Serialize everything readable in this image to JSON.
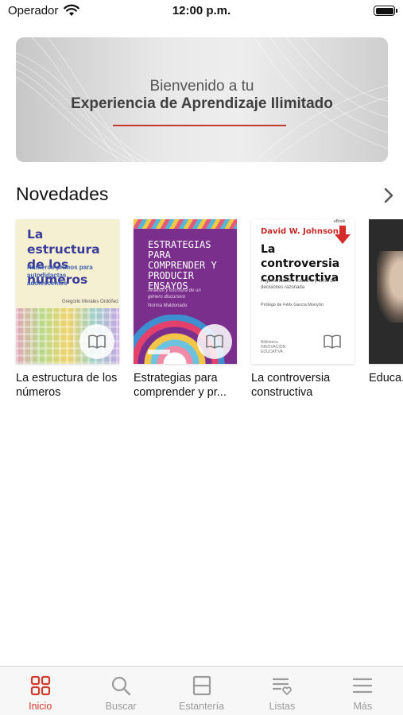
{
  "status_bar": {
    "carrier": "Operador",
    "time": "12:00 p.m."
  },
  "banner": {
    "line1": "Bienvenido a tu",
    "line2": "Experiencia de Aprendizaje Ilimitado"
  },
  "section": {
    "title": "Novedades"
  },
  "books": [
    {
      "title": "La estructura de los números",
      "cover": {
        "title": "La estructura de los números",
        "subtitle": "Números primos para autodidactas adolescentes",
        "author": "Gregorio Morales Ordóñez"
      }
    },
    {
      "title": "Estrategias para comprender y pr...",
      "cover": {
        "title": "ESTRATEGIAS PARA COMPRENDER Y PRODUCIR ENSAYOS",
        "subtitle": "Análisis y escritura de un género discursivo",
        "author": "Norma Maldonado"
      }
    },
    {
      "title": "La controversia constructiva",
      "cover": {
        "author": "David W. Johnson",
        "title": "La controversia constructiva",
        "subtitle": "Argumentación, escucha y toma de decisiones razonada",
        "prologue": "Prólogo de Félix García Moriyón",
        "badge": "eBook",
        "publisher": "Biblioteca INNOVACIÓN EDUCATIVA"
      }
    },
    {
      "title": "Educa..."
    }
  ],
  "tab_bar": {
    "tabs": [
      {
        "label": "Inicio",
        "icon": "grid-icon",
        "active": true
      },
      {
        "label": "Buscar",
        "icon": "search-icon",
        "active": false
      },
      {
        "label": "Estantería",
        "icon": "shelf-icon",
        "active": false
      },
      {
        "label": "Listas",
        "icon": "list-heart-icon",
        "active": false
      },
      {
        "label": "Más",
        "icon": "menu-icon",
        "active": false
      }
    ]
  },
  "colors": {
    "accent": "#d23b2b",
    "inactive": "#9b9b9b"
  }
}
